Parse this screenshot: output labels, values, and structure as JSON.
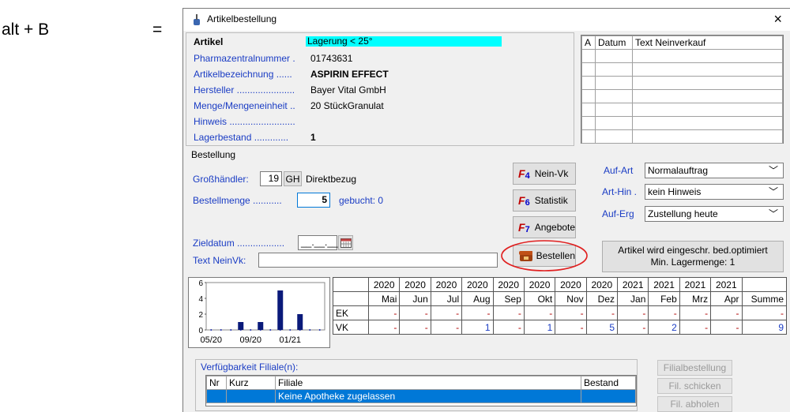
{
  "annotation": {
    "shortcut": "alt + B",
    "equals": "="
  },
  "window": {
    "title": "Artikelbestellung",
    "close": "×"
  },
  "article": {
    "section_label": "Artikel",
    "storage_badge": "Lagerung < 25°",
    "pzn_label": "Pharmazentralnummer .",
    "pzn_value": "01743631",
    "name_label": "Artikelbezeichnung ......",
    "name_value": "ASPIRIN EFFECT",
    "manufacturer_label": "Hersteller ......................",
    "manufacturer_value": "Bayer Vital GmbH",
    "quantity_label": "Menge/Mengeneinheit ..",
    "quantity_value": "20 StückGranulat",
    "note_label": "Hinweis .........................",
    "stock_label": "Lagerbestand .............",
    "stock_value": "1"
  },
  "history_table": {
    "headers": [
      "A",
      "Datum",
      "Text Neinverkauf"
    ]
  },
  "order": {
    "section_label": "Bestellung",
    "wholesaler_label": "Großhändler:",
    "wholesaler_number": "19",
    "wholesaler_code": "GH",
    "wholesaler_name": "Direktbezug",
    "amount_label": "Bestellmenge ...........",
    "amount_value": "5",
    "booked": "gebucht: 0",
    "target_date_label": "Zieldatum ..................",
    "target_date_value": "__.__.__",
    "text_label": "Text NeinVk:"
  },
  "buttons": {
    "f4": {
      "key": "F",
      "num": "4",
      "label": "Nein-Vk"
    },
    "f6": {
      "key": "F",
      "num": "6",
      "label": "Statistik"
    },
    "f7": {
      "key": "F",
      "num": "7",
      "label": "Angebote"
    },
    "order": "Bestellen",
    "optimized_line1": "Artikel wird eingeschr. bed.optimiert",
    "optimized_line2": "Min. Lagermenge: 1"
  },
  "dropdowns": {
    "art_label": "Auf-Art",
    "art_value": "Normalauftrag",
    "hint_label": "Art-Hin .",
    "hint_value": "kein Hinweis",
    "result_label": "Auf-Erg",
    "result_value": "Zustellung heute"
  },
  "chart_data": {
    "type": "bar",
    "categories": [
      "05/20",
      "06/20",
      "07/20",
      "08/20",
      "09/20",
      "10/20",
      "11/20",
      "12/20",
      "01/21",
      "02/21",
      "03/21",
      "04/21"
    ],
    "values": [
      0,
      0,
      0,
      1,
      0,
      1,
      0,
      5,
      0,
      2,
      0,
      0
    ],
    "y_ticks": [
      "6",
      "4",
      "2",
      "0"
    ],
    "x_labels": [
      "05/20",
      "09/20",
      "01/21"
    ],
    "ylim": [
      0,
      6
    ]
  },
  "stats": {
    "years": [
      "2020",
      "2020",
      "2020",
      "2020",
      "2020",
      "2020",
      "2020",
      "2020",
      "2021",
      "2021",
      "2021",
      "2021"
    ],
    "months": [
      "Mai",
      "Jun",
      "Jul",
      "Aug",
      "Sep",
      "Okt",
      "Nov",
      "Dez",
      "Jan",
      "Feb",
      "Mrz",
      "Apr"
    ],
    "sum_label": "Summe",
    "ek_label": "EK",
    "ek": [
      "-",
      "-",
      "-",
      "-",
      "-",
      "-",
      "-",
      "-",
      "-",
      "-",
      "-",
      "-",
      "-"
    ],
    "vk_label": "VK",
    "vk": [
      "-",
      "-",
      "-",
      "1",
      "-",
      "1",
      "-",
      "5",
      "-",
      "2",
      "-",
      "-",
      "9"
    ]
  },
  "availability": {
    "title": "Verfügbarkeit Filiale(n):",
    "headers": [
      "Nr",
      "Kurz",
      "Filiale",
      "Bestand"
    ],
    "row": "Keine Apotheke zugelassen",
    "btn_branch_order": "Filialbestellung",
    "btn_send": "Fil. schicken",
    "btn_fetch": "Fil. abholen"
  }
}
